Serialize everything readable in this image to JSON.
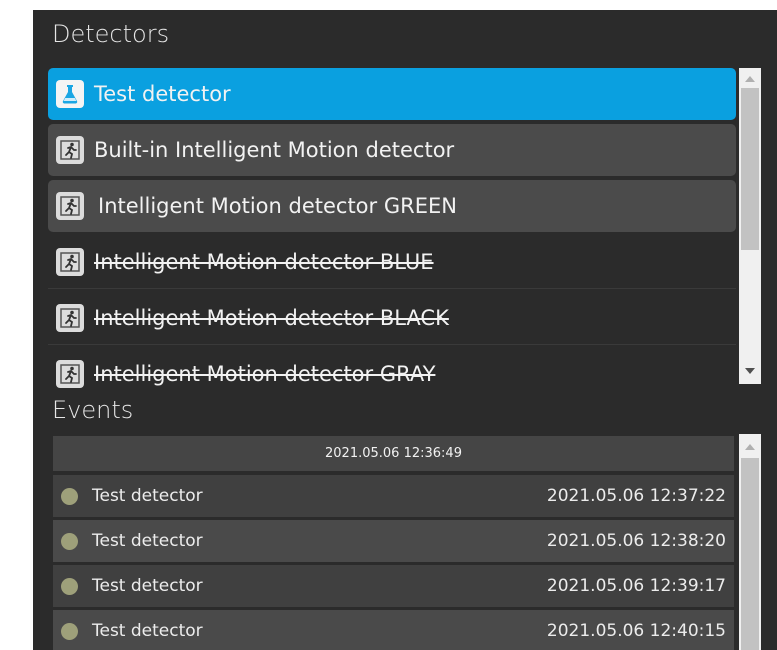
{
  "colors": {
    "panel_bg": "#2b2b2b",
    "selected_bg": "#0aa0e0",
    "item_bg": "#4b4b4b",
    "event_dot": "#9ea07a"
  },
  "detectors": {
    "title": "Detectors",
    "items": [
      {
        "label": "Test detector",
        "icon": "flask-icon",
        "state": "selected"
      },
      {
        "label": "Built-in Intelligent Motion detector",
        "icon": "running-man-icon",
        "state": "normal"
      },
      {
        "label": "Intelligent Motion detector GREEN",
        "icon": "running-man-icon",
        "state": "normal"
      },
      {
        "label": "Intelligent Motion detector BLUE",
        "icon": "running-man-icon",
        "state": "disabled"
      },
      {
        "label": "Intelligent Motion detector BLACK",
        "icon": "running-man-icon",
        "state": "disabled"
      },
      {
        "label": "Intelligent Motion detector GRAY",
        "icon": "running-man-icon",
        "state": "disabled"
      }
    ]
  },
  "events": {
    "title": "Events",
    "header_time": "2021.05.06 12:36:49",
    "rows": [
      {
        "name": "Test detector",
        "time": "2021.05.06 12:37:22"
      },
      {
        "name": "Test detector",
        "time": "2021.05.06 12:38:20"
      },
      {
        "name": "Test detector",
        "time": "2021.05.06 12:39:17"
      },
      {
        "name": "Test detector",
        "time": "2021.05.06 12:40:15"
      }
    ]
  }
}
